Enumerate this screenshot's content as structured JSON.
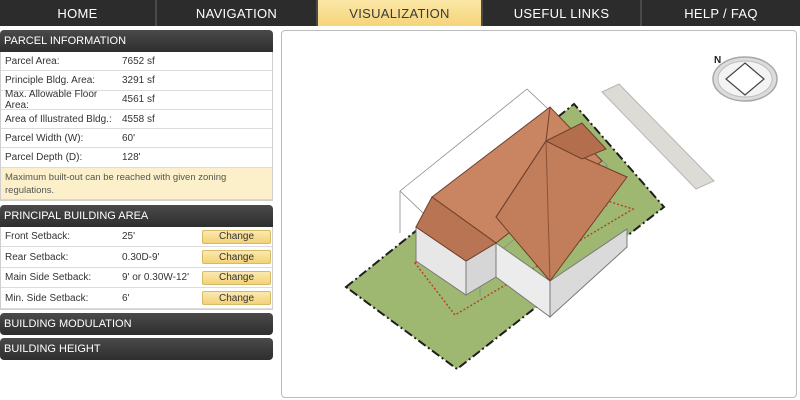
{
  "nav": {
    "tabs": [
      {
        "label": "HOME"
      },
      {
        "label": "NAVIGATION"
      },
      {
        "label": "VISUALIZATION"
      },
      {
        "label": "USEFUL LINKS"
      },
      {
        "label": "HELP / FAQ"
      }
    ],
    "active_tab": "VISUALIZATION"
  },
  "parcel": {
    "header": "PARCEL INFORMATION",
    "rows": [
      {
        "label": "Parcel Area:",
        "value": "7652 sf"
      },
      {
        "label": "Principle Bldg. Area:",
        "value": "3291 sf"
      },
      {
        "label": "Max. Allowable Floor Area:",
        "value": "4561 sf"
      },
      {
        "label": "Area of Illustrated Bldg.:",
        "value": "4558 sf"
      },
      {
        "label": "Parcel Width (W):",
        "value": "60'"
      },
      {
        "label": "Parcel Depth (D):",
        "value": "128'"
      }
    ],
    "note": "Maximum built-out can be reached with given zoning regulations."
  },
  "principal": {
    "header": "PRINCIPAL BUILDING AREA",
    "change_label": "Change",
    "rows": [
      {
        "label": "Front Setback:",
        "value": "25'"
      },
      {
        "label": "Rear Setback:",
        "value": "0.30D-9'"
      },
      {
        "label": "Main Side Setback:",
        "value": "9' or 0.30W-12'"
      },
      {
        "label": "Min. Side Setback:",
        "value": "6'"
      }
    ]
  },
  "modulation": {
    "header": "BUILDING MODULATION"
  },
  "height": {
    "header": "BUILDING HEIGHT"
  },
  "compass": {
    "label": "N"
  },
  "colors": {
    "active_tab": "#f5d47a",
    "lawn": "#9eb872",
    "roof": "#c97f5e",
    "walls": "#ececec",
    "setback_line": "#c0392b"
  }
}
